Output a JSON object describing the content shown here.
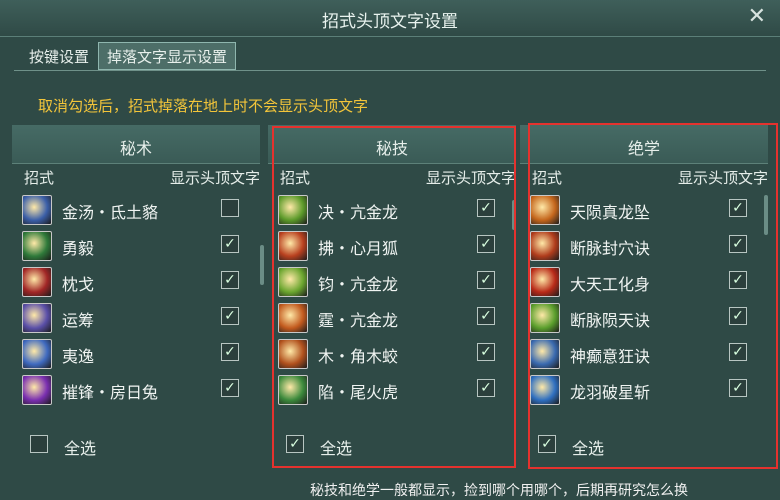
{
  "window": {
    "title": "招式头顶文字设置",
    "close_label": "✕"
  },
  "tabs": [
    {
      "label": "按键设置",
      "active": false
    },
    {
      "label": "掉落文字显示设置",
      "active": true
    }
  ],
  "hint": "取消勾选后，招式掉落在地上时不会显示头顶文字",
  "columns": {
    "left": "招式",
    "right": "显示头顶文字"
  },
  "panels": [
    {
      "title": "秘术",
      "skills": [
        {
          "name": "金汤・氐土貉",
          "checked": false,
          "icon": "vortex-skill-icon",
          "color": "#3b5fa8"
        },
        {
          "name": "勇毅",
          "checked": true,
          "icon": "figure-skill-icon",
          "color": "#2f7a3a"
        },
        {
          "name": "枕戈",
          "checked": true,
          "icon": "red-burst-skill-icon",
          "color": "#a12626"
        },
        {
          "name": "运筹",
          "checked": true,
          "icon": "swirl-skill-icon",
          "color": "#5a4fa8"
        },
        {
          "name": "夷逸",
          "checked": true,
          "icon": "aura-skill-icon",
          "color": "#3f6ac0"
        },
        {
          "name": "摧锋・房日兔",
          "checked": true,
          "icon": "slash-skill-icon",
          "color": "#7a2fb0"
        }
      ],
      "select_all": {
        "label": "全选",
        "checked": false
      }
    },
    {
      "title": "秘技",
      "skills": [
        {
          "name": "决・亢金龙",
          "checked": true,
          "icon": "green-slash-skill-icon",
          "color": "#5c9a2a"
        },
        {
          "name": "拂・心月狐",
          "checked": true,
          "icon": "fire-skill-icon",
          "color": "#b8401f"
        },
        {
          "name": "钧・亢金龙",
          "checked": true,
          "icon": "green-burst-skill-icon",
          "color": "#6aa52e"
        },
        {
          "name": "霆・亢金龙",
          "checked": true,
          "icon": "flame-strike-skill-icon",
          "color": "#c25a1e"
        },
        {
          "name": "木・角木蛟",
          "checked": true,
          "icon": "fire-pillar-skill-icon",
          "color": "#b0501c"
        },
        {
          "name": "陷・尾火虎",
          "checked": true,
          "icon": "green-swirl-skill-icon",
          "color": "#3c8a3c"
        }
      ],
      "select_all": {
        "label": "全选",
        "checked": true
      }
    },
    {
      "title": "绝学",
      "skills": [
        {
          "name": "天陨真龙坠",
          "checked": true,
          "icon": "fire-rain-skill-icon",
          "color": "#c4661c"
        },
        {
          "name": "断脉封穴诀",
          "checked": true,
          "icon": "red-eye-skill-icon",
          "color": "#b03c1c"
        },
        {
          "name": "大天工化身",
          "checked": true,
          "icon": "inferno-skill-icon",
          "color": "#b82a18"
        },
        {
          "name": "断脉陨天诀",
          "checked": true,
          "icon": "green-bolt-skill-icon",
          "color": "#5a9e2c"
        },
        {
          "name": "神癫意狂诀",
          "checked": true,
          "icon": "sphere-skill-icon",
          "color": "#3a6ab0"
        },
        {
          "name": "龙羽破星斩",
          "checked": true,
          "icon": "star-slash-skill-icon",
          "color": "#2f6fc0"
        }
      ],
      "select_all": {
        "label": "全选",
        "checked": true
      }
    }
  ],
  "note": "秘技和绝学一般都显示，捡到哪个用哪个，后期再研究怎么换",
  "colors": {
    "highlight_box": "#e5322e",
    "hint_text": "#f3c53a"
  }
}
